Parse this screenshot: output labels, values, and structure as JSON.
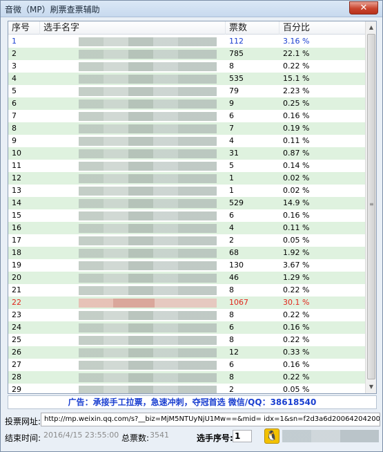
{
  "window": {
    "title": "音微（MP）刷票查票辅助",
    "close_label": "✕"
  },
  "columns": {
    "idx": "序号",
    "name": "选手名字",
    "votes": "票数",
    "pct": "百分比"
  },
  "rows": [
    {
      "idx": "1",
      "votes": "112",
      "pct": "3.16 %",
      "state": "selected"
    },
    {
      "idx": "2",
      "votes": "785",
      "pct": "22.1 %"
    },
    {
      "idx": "3",
      "votes": "8",
      "pct": "0.22 %"
    },
    {
      "idx": "4",
      "votes": "535",
      "pct": "15.1 %"
    },
    {
      "idx": "5",
      "votes": "79",
      "pct": "2.23 %"
    },
    {
      "idx": "6",
      "votes": "9",
      "pct": "0.25 %"
    },
    {
      "idx": "7",
      "votes": "6",
      "pct": "0.16 %"
    },
    {
      "idx": "8",
      "votes": "7",
      "pct": "0.19 %"
    },
    {
      "idx": "9",
      "votes": "4",
      "pct": "0.11 %"
    },
    {
      "idx": "10",
      "votes": "31",
      "pct": "0.87 %"
    },
    {
      "idx": "11",
      "votes": "5",
      "pct": "0.14 %"
    },
    {
      "idx": "12",
      "votes": "1",
      "pct": "0.02 %"
    },
    {
      "idx": "13",
      "votes": "1",
      "pct": "0.02 %"
    },
    {
      "idx": "14",
      "votes": "529",
      "pct": "14.9 %"
    },
    {
      "idx": "15",
      "votes": "6",
      "pct": "0.16 %"
    },
    {
      "idx": "16",
      "votes": "4",
      "pct": "0.11 %"
    },
    {
      "idx": "17",
      "votes": "2",
      "pct": "0.05 %"
    },
    {
      "idx": "18",
      "votes": "68",
      "pct": "1.92 %"
    },
    {
      "idx": "19",
      "votes": "130",
      "pct": "3.67 %"
    },
    {
      "idx": "20",
      "votes": "46",
      "pct": "1.29 %"
    },
    {
      "idx": "21",
      "votes": "8",
      "pct": "0.22 %"
    },
    {
      "idx": "22",
      "votes": "1067",
      "pct": "30.1 %",
      "state": "highlight"
    },
    {
      "idx": "23",
      "votes": "8",
      "pct": "0.22 %"
    },
    {
      "idx": "24",
      "votes": "6",
      "pct": "0.16 %"
    },
    {
      "idx": "25",
      "votes": "8",
      "pct": "0.22 %"
    },
    {
      "idx": "26",
      "votes": "12",
      "pct": "0.33 %"
    },
    {
      "idx": "27",
      "votes": "6",
      "pct": "0.16 %"
    },
    {
      "idx": "28",
      "votes": "8",
      "pct": "0.22 %"
    },
    {
      "idx": "29",
      "votes": "2",
      "pct": "0.05 %"
    }
  ],
  "ad": {
    "text": "广告：承接手工拉票，急速冲刺，夺冠首选  微信/QQ：38618540"
  },
  "url": {
    "label": "投票网址:",
    "value": "http://mp.weixin.qq.com/s?__biz=MjM5NTUyNjU1Mw==&mid=           idx=1&sn=f2d3a6d20064204200"
  },
  "footer": {
    "end_label": "结束时间:",
    "end_value": "2016/4/15 23:55:00",
    "total_label": "总票数:",
    "total_value": "3541",
    "pick_label": "选手序号:",
    "pick_value": "1"
  },
  "colors": {
    "selected_text": "#1a3fd0",
    "highlight_text": "#e0241a",
    "alt_row": "#dff2df",
    "ad_text": "#1a3fd0"
  },
  "icons": {
    "qq": "penguin-icon"
  }
}
